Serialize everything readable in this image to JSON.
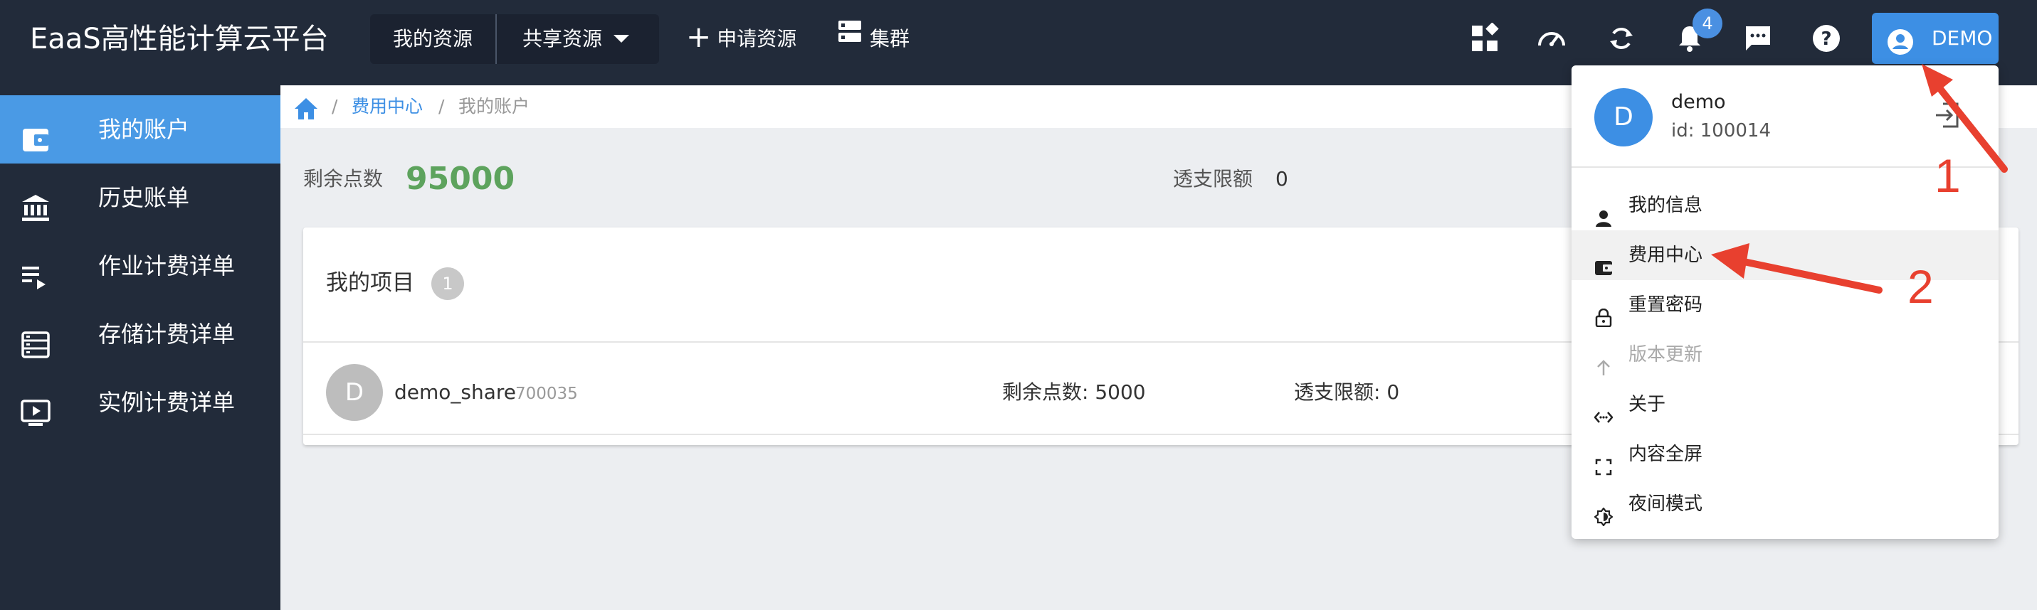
{
  "app": {
    "title": "EaaS高性能计算云平台"
  },
  "nav": {
    "my_resources": "我的资源",
    "shared_resources": "共享资源",
    "apply_resources": "申请资源",
    "cluster": "集群"
  },
  "toolbar": {
    "icons": [
      "widgets-icon",
      "speedometer-icon",
      "sync-icon",
      "bell-icon",
      "message-icon",
      "help-icon"
    ],
    "notification_count": "4",
    "user_label": "DEMO"
  },
  "sidebar": {
    "items": [
      {
        "label": "我的账户",
        "icon": "wallet-icon",
        "active": true
      },
      {
        "label": "历史账单",
        "icon": "bank-icon",
        "active": false
      },
      {
        "label": "作业计费详单",
        "icon": "playlist-play-icon",
        "active": false
      },
      {
        "label": "存储计费详单",
        "icon": "storage-list-icon",
        "active": false
      },
      {
        "label": "实例计费详单",
        "icon": "monitor-play-icon",
        "active": false
      }
    ]
  },
  "breadcrumb": {
    "home_icon": "home-icon",
    "parent": "费用中心",
    "current": "我的账户",
    "separator": "/"
  },
  "account": {
    "remaining_label": "剩余点数",
    "remaining_value": "95000",
    "overdraft_label": "透支限额",
    "overdraft_value": "0"
  },
  "projects": {
    "title": "我的项目",
    "count": "1",
    "rows": [
      {
        "avatar": "D",
        "name": "demo_share",
        "id": "700035",
        "remaining": "剩余点数: 5000",
        "overdraft": "透支限额: 0"
      }
    ]
  },
  "user_menu": {
    "avatar": "D",
    "name": "demo",
    "id_text": "id: 100014",
    "items": [
      {
        "label": "我的信息",
        "icon": "person-icon",
        "highlighted": false,
        "disabled": false
      },
      {
        "label": "费用中心",
        "icon": "wallet-icon",
        "highlighted": true,
        "disabled": false
      },
      {
        "label": "重置密码",
        "icon": "lock-icon",
        "highlighted": false,
        "disabled": false
      },
      {
        "label": "版本更新",
        "icon": "arrow-up-icon",
        "highlighted": false,
        "disabled": true
      },
      {
        "label": "关于",
        "icon": "code-icon",
        "highlighted": false,
        "disabled": false
      },
      {
        "label": "内容全屏",
        "icon": "fullscreen-icon",
        "highlighted": false,
        "disabled": false
      },
      {
        "label": "夜间模式",
        "icon": "theme-icon",
        "highlighted": false,
        "disabled": false
      }
    ]
  },
  "annotations": {
    "step1": "1",
    "step2": "2"
  },
  "colors": {
    "topbar": "#222b3a",
    "accent": "#3d8fe4",
    "active_sidebar": "#4a9ae5",
    "points_green": "#5da35d",
    "annotation_red": "#e8402f"
  }
}
